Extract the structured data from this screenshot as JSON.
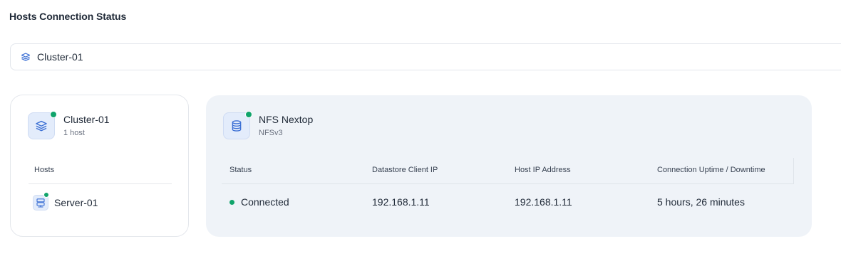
{
  "page": {
    "title": "Hosts Connection Status"
  },
  "cluster_selector": {
    "icon": "layers-icon",
    "value": "Cluster-01"
  },
  "cluster_card": {
    "icon": "layers-icon",
    "name": "Cluster-01",
    "subtitle": "1 host",
    "status": "online",
    "hosts_header": "Hosts",
    "hosts": [
      {
        "icon": "server-icon",
        "name": "Server-01",
        "status": "online"
      }
    ]
  },
  "datastore_card": {
    "icon": "database-icon",
    "name": "NFS Nextop",
    "subtitle": "NFSv3",
    "status": "online",
    "table": {
      "columns": [
        "Status",
        "Datastore Client IP",
        "Host IP Address",
        "Connection Uptime / Downtime"
      ],
      "rows": [
        {
          "status": "Connected",
          "datastore_client_ip": "192.168.1.11",
          "host_ip": "192.168.1.11",
          "uptime": "5 hours, 26 minutes"
        }
      ]
    }
  },
  "colors": {
    "status_online": "#10a46b",
    "icon_accent": "#3b6fd4",
    "icon_bg": "#e3ecfb",
    "panel_bg": "#eff3f8"
  }
}
